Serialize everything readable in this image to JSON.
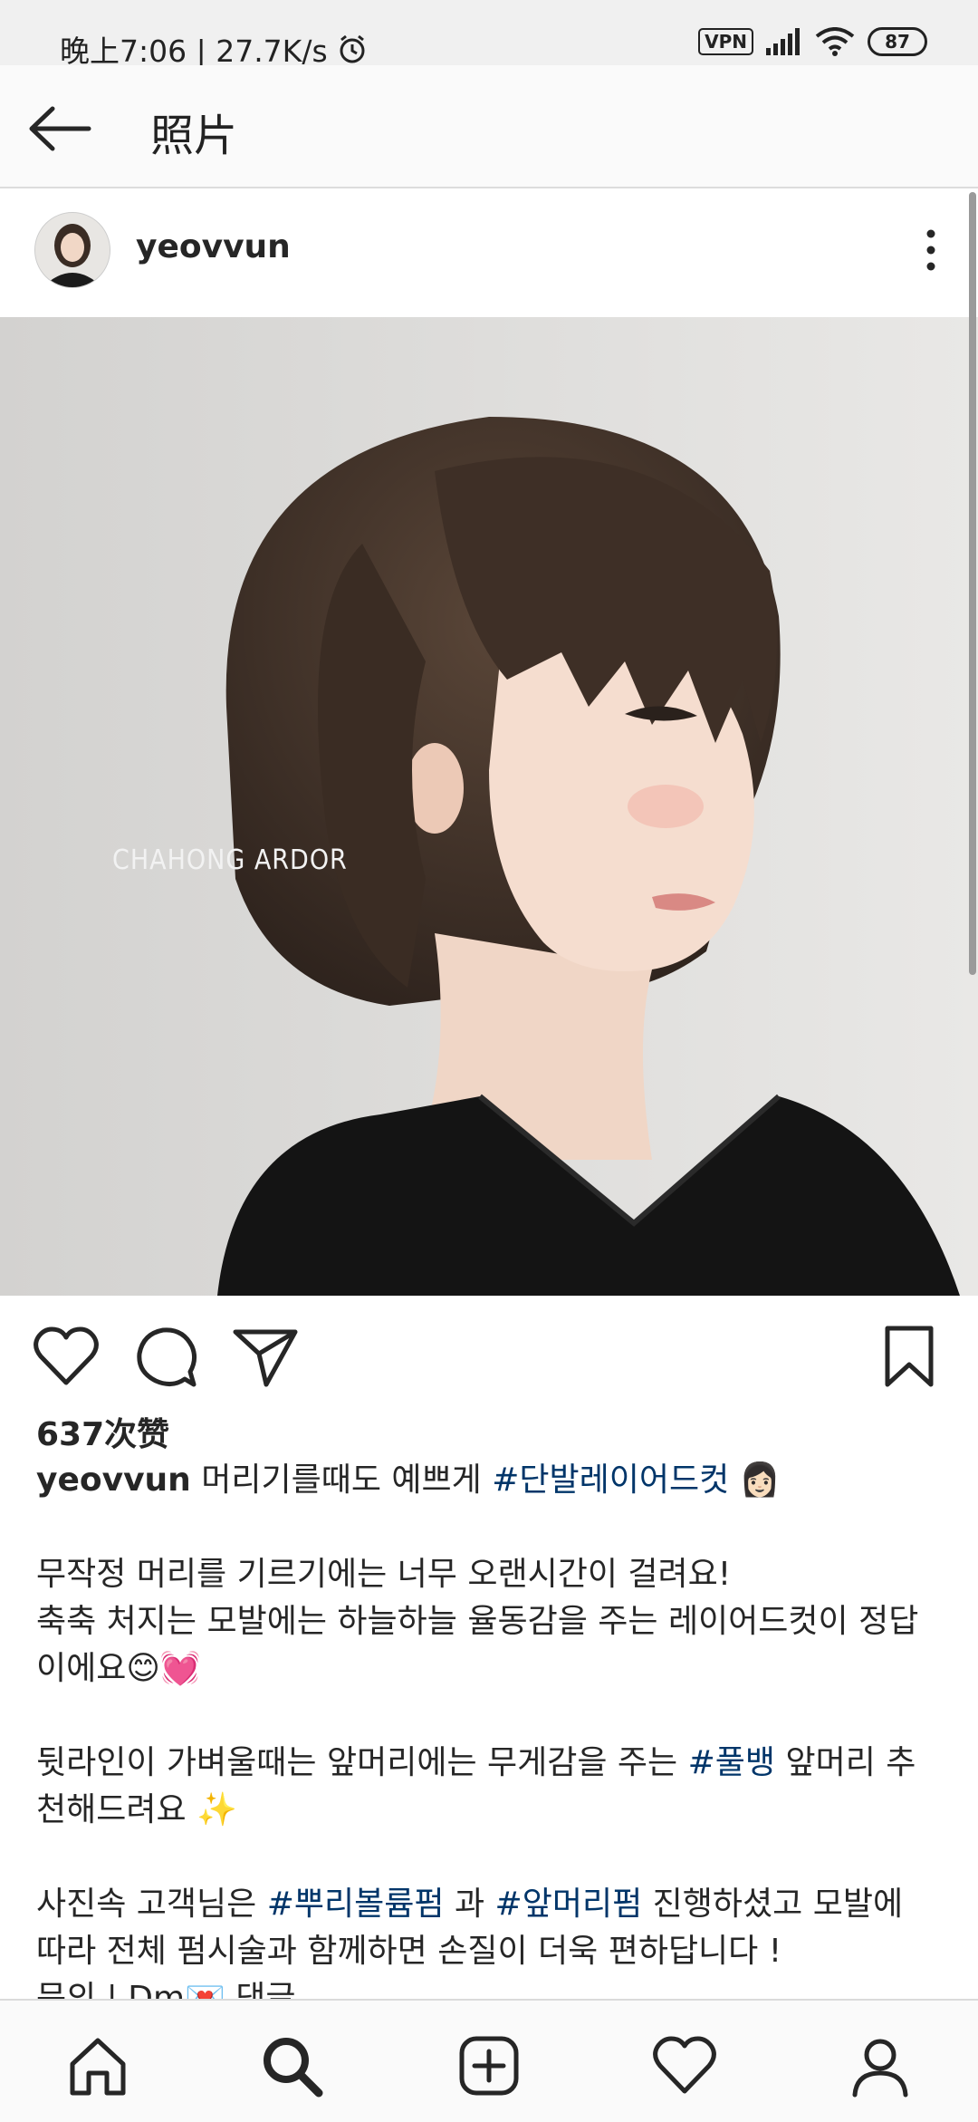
{
  "status_bar": {
    "time_speed": "晚上7:06 | 27.7K/s",
    "vpn": "VPN",
    "battery": "87"
  },
  "app_bar": {
    "title": "照片"
  },
  "post": {
    "username": "yeovvun",
    "watermark": "CHAHONG ARDOR",
    "likes": "637次赞",
    "caption": {
      "line1_text": "머리기를때도 예쁘게",
      "line1_tag": "#단발레이어드컷",
      "line1_emoji": "👩🏻",
      "p2_l1": "무작정 머리를 기르기에는 너무 오랜시간이 걸려요!",
      "p2_l2": "축축 처지는 모발에는 하늘하늘 율동감을 주는 레이어드컷이 정답이에요😊💓",
      "p3_pre": "뒷라인이 가벼울때는 앞머리에는 무게감을 주는",
      "p3_tag": "#풀뱅",
      "p3_post": "앞머리 추천해드려요 ✨",
      "p4_pre": "사진속 고객님은",
      "p4_tag1": "#뿌리볼륨펌",
      "p4_mid": "과",
      "p4_tag2": "#앞머리펌",
      "p4_post": "진행하셨고 모발에 따라 전체 펌시술과 함께하면 손질이 더욱 편하답니다 !",
      "p5": "문의 | Dm💌 댓글"
    }
  },
  "colors": {
    "hashtag": "#003569",
    "text": "#262626",
    "status_bg": "#f0f0f0"
  }
}
